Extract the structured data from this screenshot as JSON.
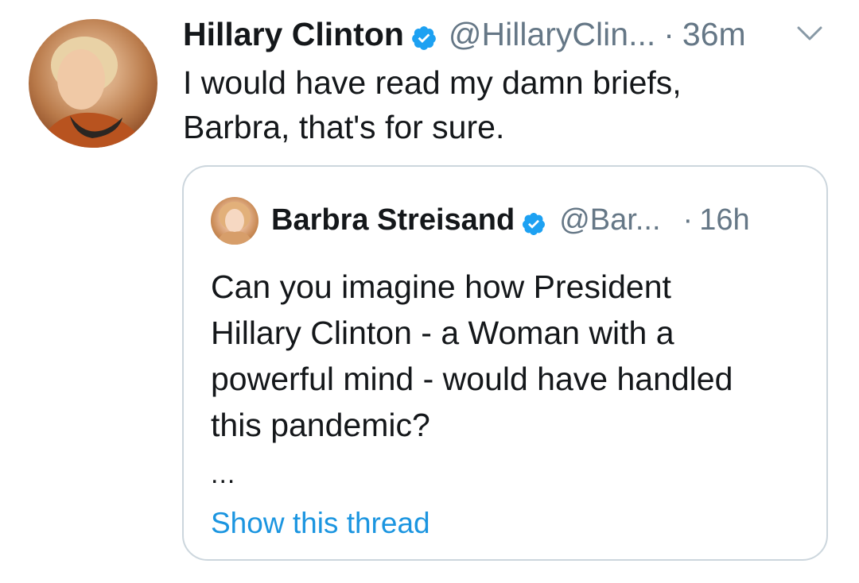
{
  "tweet": {
    "author_name": "Hillary Clinton",
    "author_handle": "@HillaryClin...",
    "separator": "·",
    "time": "36m",
    "text_lines": [
      "I would have read my damn briefs,",
      "Barbra, that's for sure."
    ],
    "avatar_icon": "profile-photo",
    "verified_icon": "verified-badge-icon",
    "menu_icon": "chevron-down-icon"
  },
  "quoted": {
    "author_name": "Barbra Streisand",
    "author_handle": "@Bar...",
    "separator": "·",
    "time": "16h",
    "text_lines": [
      "Can you imagine how President",
      "Hillary Clinton - a Woman with a",
      "powerful mind - would have handled",
      "this pandemic?"
    ],
    "ellipsis": "...",
    "show_thread_label": "Show this thread"
  },
  "colors": {
    "text_primary": "#14171a",
    "text_secondary": "#657786",
    "link": "#1b95e0",
    "verified": "#1da1f2",
    "border": "#ccd6dd"
  }
}
